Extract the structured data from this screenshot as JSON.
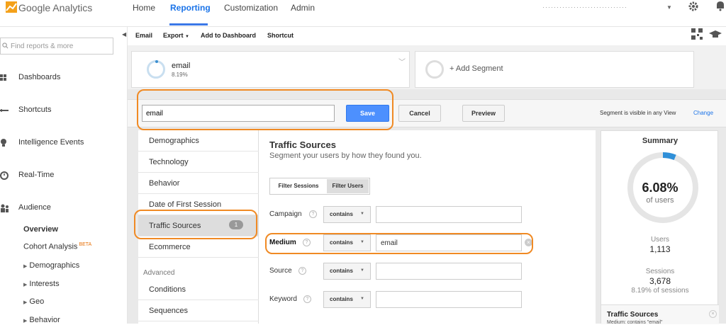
{
  "app": {
    "logo_text": "Google Analytics",
    "account_text": "······························"
  },
  "topnav": {
    "home": "Home",
    "reporting": "Reporting",
    "customization": "Customization",
    "admin": "Admin"
  },
  "sidebar": {
    "search_placeholder": "Find reports & more",
    "items": [
      {
        "label": "Dashboards",
        "icon": "grid-icon"
      },
      {
        "label": "Shortcuts",
        "icon": "shortcut-icon"
      },
      {
        "label": "Intelligence Events",
        "icon": "lightbulb-icon"
      },
      {
        "label": "Real-Time",
        "icon": "clock-icon"
      },
      {
        "label": "Audience",
        "icon": "people-icon"
      }
    ],
    "audience_sub": {
      "overview": "Overview",
      "cohort": "Cohort Analysis",
      "beta": "BETA",
      "demographics": "Demographics",
      "interests": "Interests",
      "geo": "Geo",
      "behavior": "Behavior"
    }
  },
  "toolbar": {
    "email": "Email",
    "export": "Export",
    "add_to_dashboard": "Add to Dashboard",
    "shortcut": "Shortcut"
  },
  "segments": {
    "email_name": "email",
    "email_pct": "8.19%",
    "add_segment": "+ Add Segment"
  },
  "editor": {
    "segment_name": "email",
    "save": "Save",
    "cancel": "Cancel",
    "preview": "Preview",
    "visible_text": "Segment is visible in any View",
    "change": "Change",
    "categories": [
      "Demographics",
      "Technology",
      "Behavior",
      "Date of First Session",
      "Traffic Sources",
      "Ecommerce"
    ],
    "traffic_badge": "1",
    "advanced_label": "Advanced",
    "advanced": [
      "Conditions",
      "Sequences"
    ]
  },
  "traffic_panel": {
    "title": "Traffic Sources",
    "subtitle": "Segment your users by how they found you.",
    "filter_sessions": "Filter Sessions",
    "filter_users": "Filter Users",
    "rows": [
      {
        "label": "Campaign",
        "op": "contains",
        "value": ""
      },
      {
        "label": "Medium",
        "op": "contains",
        "value": "email"
      },
      {
        "label": "Source",
        "op": "contains",
        "value": ""
      },
      {
        "label": "Keyword",
        "op": "contains",
        "value": ""
      }
    ]
  },
  "summary": {
    "title": "Summary",
    "pct": "6.08%",
    "of_users": "of users",
    "ring_fraction": 0.0608,
    "users_label": "Users",
    "users_value": "1,113",
    "sessions_label": "Sessions",
    "sessions_value": "3,678",
    "sessions_pct": "8.19% of sessions",
    "ts_title": "Traffic Sources",
    "ts_desc": "Medium: contains \"email\""
  },
  "colors": {
    "accent": "#3b78e7",
    "highlight": "#f08a24"
  }
}
